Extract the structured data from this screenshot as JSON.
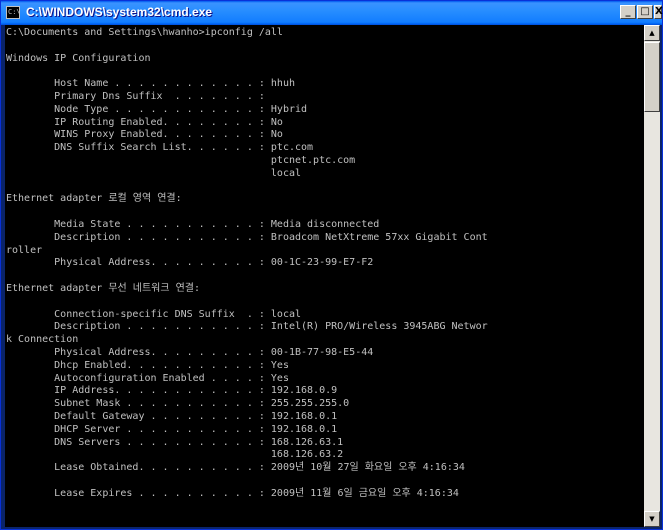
{
  "window": {
    "title": "C:\\WINDOWS\\system32\\cmd.exe",
    "icon": "cmd-icon",
    "controls": {
      "minimize": "_",
      "maximize": "□",
      "close": "X"
    }
  },
  "console": {
    "lines": [
      "C:\\Documents and Settings\\hwanho>ipconfig /all",
      "",
      "Windows IP Configuration",
      "",
      "        Host Name . . . . . . . . . . . . : hhuh",
      "        Primary Dns Suffix  . . . . . . . :",
      "        Node Type . . . . . . . . . . . . : Hybrid",
      "        IP Routing Enabled. . . . . . . . : No",
      "        WINS Proxy Enabled. . . . . . . . : No",
      "        DNS Suffix Search List. . . . . . : ptc.com",
      "                                            ptcnet.ptc.com",
      "                                            local",
      "",
      "Ethernet adapter 로컬 영역 연결:",
      "",
      "        Media State . . . . . . . . . . . : Media disconnected",
      "        Description . . . . . . . . . . . : Broadcom NetXtreme 57xx Gigabit Cont",
      "roller",
      "        Physical Address. . . . . . . . . : 00-1C-23-99-E7-F2",
      "",
      "Ethernet adapter 무선 네트워크 연결:",
      "",
      "        Connection-specific DNS Suffix  . : local",
      "        Description . . . . . . . . . . . : Intel(R) PRO/Wireless 3945ABG Networ",
      "k Connection",
      "        Physical Address. . . . . . . . . : 00-1B-77-98-E5-44",
      "        Dhcp Enabled. . . . . . . . . . . : Yes",
      "        Autoconfiguration Enabled . . . . : Yes",
      "        IP Address. . . . . . . . . . . . : 192.168.0.9",
      "        Subnet Mask . . . . . . . . . . . : 255.255.255.0",
      "        Default Gateway . . . . . . . . . : 192.168.0.1",
      "        DHCP Server . . . . . . . . . . . : 192.168.0.1",
      "        DNS Servers . . . . . . . . . . . : 168.126.63.1",
      "                                            168.126.63.2",
      "        Lease Obtained. . . . . . . . . . : 2009년 10월 27일 화요일 오후 4:16:34",
      "",
      "        Lease Expires . . . . . . . . . . : 2009년 11월 6일 금요일 오후 4:16:34"
    ]
  },
  "colors": {
    "titlebar": "#0054E3",
    "console_bg": "#000000",
    "console_fg": "#C0C0C0"
  }
}
